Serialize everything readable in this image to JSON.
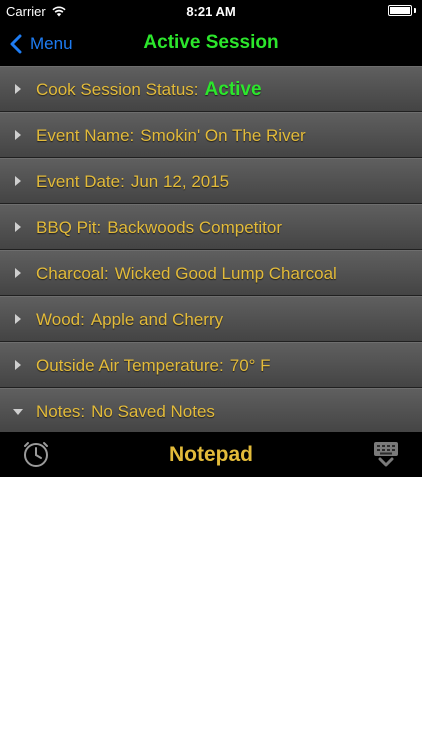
{
  "status_bar": {
    "carrier": "Carrier",
    "time": "8:21 AM"
  },
  "nav": {
    "back_label": "Menu",
    "title": "Active Session"
  },
  "rows": [
    {
      "label": "Cook Session Status:",
      "value": "Active"
    },
    {
      "label": "Event Name:",
      "value": "Smokin' On The River"
    },
    {
      "label": "Event Date:",
      "value": "Jun 12, 2015"
    },
    {
      "label": "BBQ Pit:",
      "value": "Backwoods Competitor"
    },
    {
      "label": "Charcoal:",
      "value": "Wicked Good Lump Charcoal"
    },
    {
      "label": "Wood:",
      "value": "Apple and Cherry"
    },
    {
      "label": "Outside Air Temperature:",
      "value": "70° F"
    },
    {
      "label": "Notes:",
      "value": "No Saved Notes"
    }
  ],
  "toolbar": {
    "title": "Notepad",
    "left_icon": "clock-icon",
    "right_icon": "keyboard-dismiss-icon"
  },
  "colors": {
    "accent_green": "#2ce62c",
    "label_gold": "#e3bb3a",
    "link_blue": "#1e7cf2"
  }
}
